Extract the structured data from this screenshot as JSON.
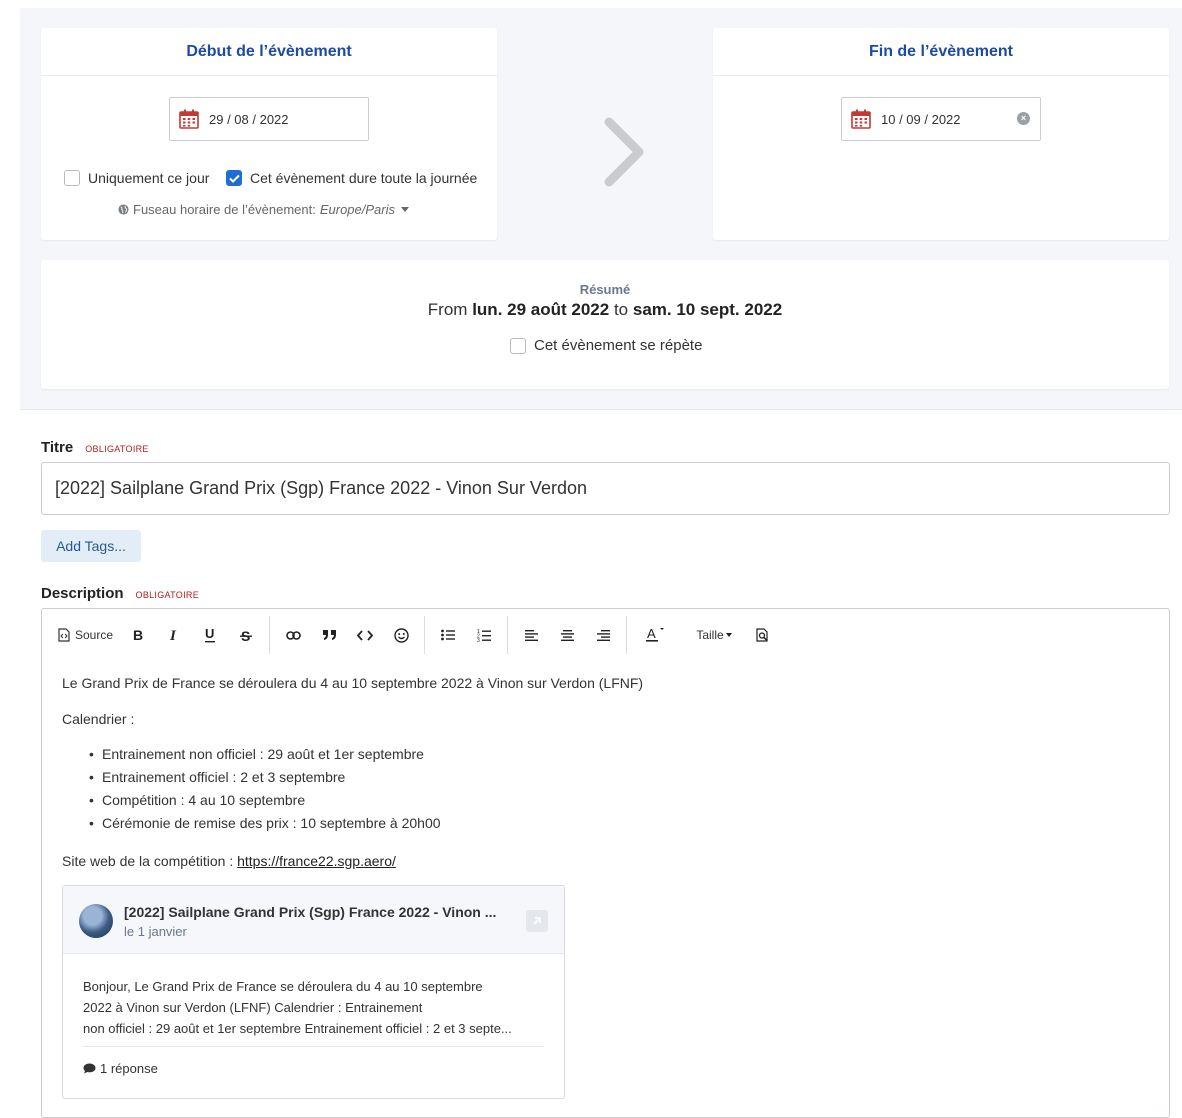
{
  "start": {
    "header": "Début de l’évènement",
    "date_value": "29 / 08 / 2022",
    "only_this_day_label": "Uniquement ce jour",
    "all_day_label": "Cet évènement dure toute la journée",
    "all_day_checked": true,
    "timezone_label": "Fuseau horaire de l’évènement:",
    "timezone_value": "Europe/Paris"
  },
  "end": {
    "header": "Fin de l’évènement",
    "date_value": "10 / 09 / 2022"
  },
  "summary": {
    "label": "Résumé",
    "from_word": "From",
    "from_date": "lun. 29 août 2022",
    "to_word": "to",
    "to_date": "sam. 10 sept. 2022",
    "repeat_label": "Cet évènement se répète"
  },
  "title_field": {
    "label": "Titre",
    "required": "OBLIGATOIRE",
    "value": "[2022] Sailplane Grand Prix (Sgp) France 2022 - Vinon Sur Verdon"
  },
  "tags_button": "Add Tags...",
  "description_field": {
    "label": "Description",
    "required": "OBLIGATOIRE"
  },
  "toolbar": {
    "source_label": "Source",
    "size_label": "Taille"
  },
  "editor": {
    "intro": "Le Grand Prix de France se déroulera du 4 au 10 septembre 2022 à Vinon sur Verdon (LFNF)",
    "calendar_label": "Calendrier :",
    "items": [
      "Entrainement non officiel : 29 août et 1er septembre",
      "Entrainement officiel : 2 et 3 septembre",
      "Compétition : 4 au 10 septembre",
      "Cérémonie de remise des prix : 10 septembre à 20h00"
    ],
    "website_label": "Site web de la compétition :",
    "website_url": "https://france22.sgp.aero/"
  },
  "onebox": {
    "title": "[2022] Sailplane Grand Prix (Sgp) France 2022 - Vinon ...",
    "date": "le 1 janvier",
    "body_lines": [
      "Bonjour,   Le Grand Prix de France se déroulera du 4 au 10 septembre",
      "2022 à Vinon sur Verdon (LFNF)   Calendrier : Entrainement",
      "non officiel : 29 août et 1er septembre Entrainement officiel : 2 et 3 septe..."
    ],
    "replies": "1 réponse"
  }
}
